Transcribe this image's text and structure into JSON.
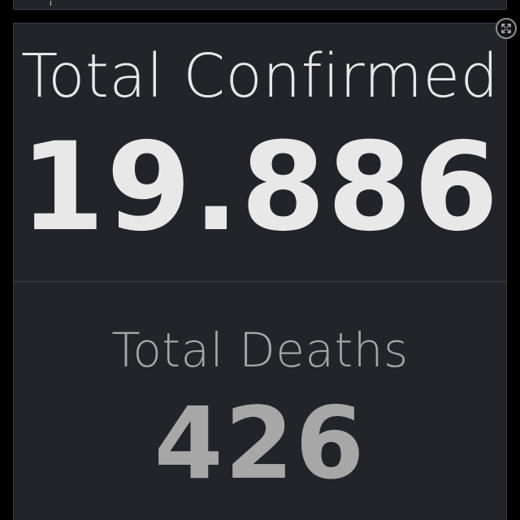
{
  "stats": [
    {
      "label": "Total Confirmed",
      "value": "19.886"
    },
    {
      "label": "Total Deaths",
      "value": "426"
    }
  ],
  "top_panel": {
    "glyph": "ʃ"
  },
  "colors": {
    "background": "#000000",
    "panel": "#222429",
    "border": "#3a3d44",
    "primary_text": "#e8e8e8",
    "secondary_text": "#a5a5a5"
  },
  "icons": {
    "expand": "expand-icon"
  }
}
